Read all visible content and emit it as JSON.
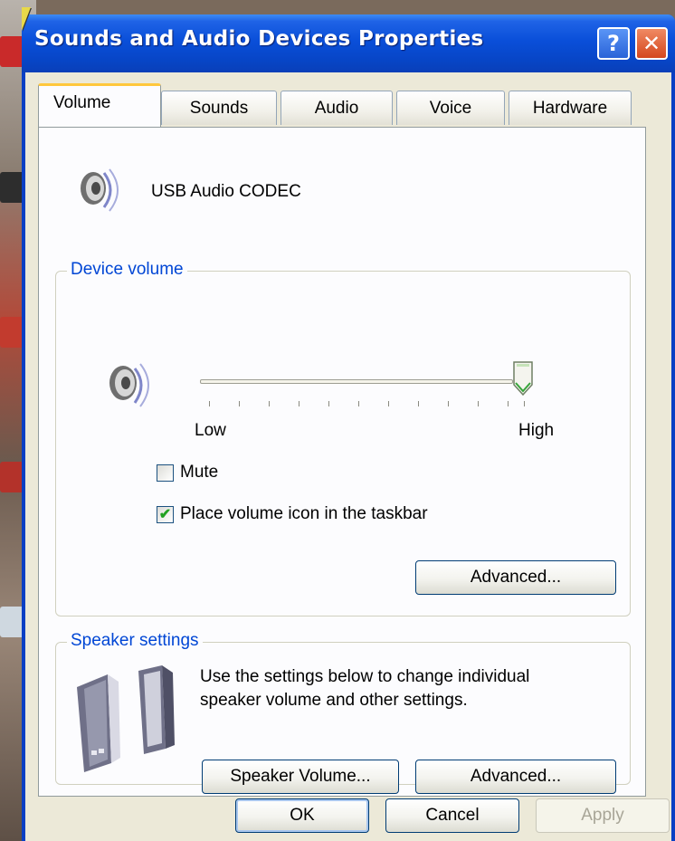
{
  "window": {
    "title": "Sounds and Audio Devices Properties",
    "help_glyph": "?",
    "close_glyph": "✕"
  },
  "tabs": [
    {
      "label": "Volume",
      "active": true
    },
    {
      "label": "Sounds",
      "active": false
    },
    {
      "label": "Audio",
      "active": false
    },
    {
      "label": "Voice",
      "active": false
    },
    {
      "label": "Hardware",
      "active": false
    }
  ],
  "device": {
    "icon": "speaker-icon",
    "name": "USB Audio CODEC"
  },
  "device_volume": {
    "label": "Device volume",
    "icon": "speaker-icon",
    "slider_low": "Low",
    "slider_high": "High",
    "level_fraction": 1.0,
    "mute": {
      "label": "Mute",
      "checked": false
    },
    "taskbar_icon": {
      "label": "Place volume icon in the taskbar",
      "checked": true
    },
    "advanced_label": "Advanced..."
  },
  "speaker_settings": {
    "label": "Speaker settings",
    "icon": "speakers-icon",
    "description_line1": "Use the settings below to change individual",
    "description_line2": "speaker volume and other settings.",
    "speaker_volume_label": "Speaker Volume...",
    "advanced_label": "Advanced..."
  },
  "footer": {
    "ok_label": "OK",
    "cancel_label": "Cancel",
    "apply_label": "Apply"
  },
  "colors": {
    "titlebar": "#0a4fd9",
    "group_label": "#0046d5",
    "tab_highlight": "#ffc73c",
    "checkmark": "#21a121"
  }
}
